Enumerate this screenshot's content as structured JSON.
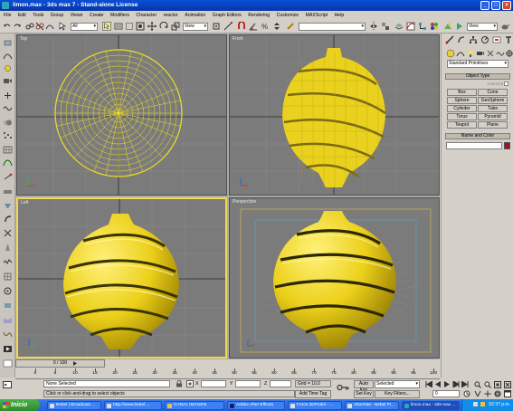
{
  "window": {
    "title": "limon.max - 3ds max 7 - Stand-alone License",
    "controls": [
      "minimize",
      "maximize",
      "close"
    ]
  },
  "menu": [
    "File",
    "Edit",
    "Tools",
    "Group",
    "Views",
    "Create",
    "Modifiers",
    "Character",
    "reactor",
    "Animation",
    "Graph Editors",
    "Rendering",
    "Customize",
    "MAXScript",
    "Help"
  ],
  "toolbar": {
    "selection_filter": "All",
    "ref_coord": "View",
    "named_selection": "",
    "view_dropdown": "View"
  },
  "viewports": {
    "top": {
      "label": "Top"
    },
    "front": {
      "label": "Front"
    },
    "left": {
      "label": "Left"
    },
    "perspective": {
      "label": "Perspective"
    }
  },
  "command_panel": {
    "category_dropdown": "Standard Primitives",
    "object_type_title": "Object Type",
    "autogrid": "AutoGrid",
    "primitives": [
      "Box",
      "Cone",
      "Sphere",
      "GeoSphere",
      "Cylinder",
      "Tube",
      "Torus",
      "Pyramid",
      "Teapot",
      "Plane"
    ],
    "name_color_title": "Name and Color",
    "accent_color": "#a01030"
  },
  "timeline": {
    "slider": "0 / 100",
    "ticks": [
      "0",
      "5",
      "10",
      "15",
      "20",
      "25",
      "30",
      "35",
      "40",
      "45",
      "50",
      "55",
      "60",
      "65",
      "70",
      "75",
      "80",
      "85",
      "90",
      "95",
      "100"
    ]
  },
  "status": {
    "selection": "None Selected",
    "prompt": "Click or click-and-drag to select objects",
    "x_label": "X",
    "y_label": "Y",
    "z_label": "Z",
    "grid": "Grid = 10,0",
    "add_time_tag": "Add Time Tag",
    "auto_key": "Auto Key",
    "set_key": "Set Key",
    "key_mode": "Selected",
    "key_filters": "Key Filters...",
    "frame": "0"
  },
  "taskbar": {
    "start_label": "Inicio",
    "tasks": [
      "Bebel | Broadcast ...",
      "http://www.bebel....",
      "CANAL IMAGEN",
      "Adobe After Effects",
      "Foros 3DPoder - ...",
      "AltaVista - Bebel Pi...",
      "limon.max - 3ds max ..."
    ],
    "clock": "02:37 p.m."
  }
}
